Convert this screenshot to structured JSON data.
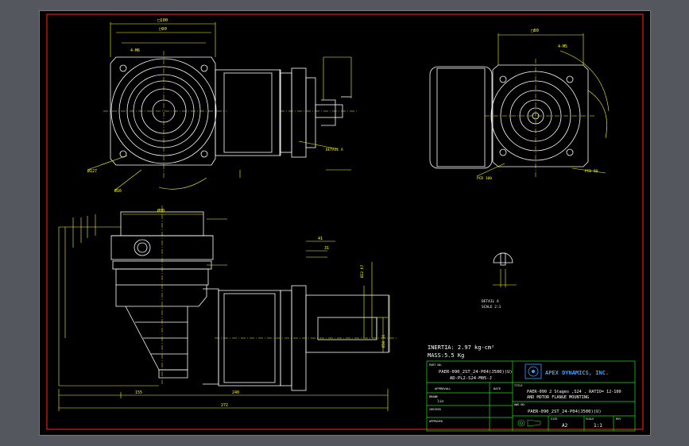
{
  "colors": {
    "background": "#54575e",
    "sheet": "#000000",
    "frame": "#e01b1b",
    "linework": "#ffffff",
    "dimension": "#ffff00",
    "titleblock": "#22dd22",
    "text": "#ffffff"
  },
  "notes": {
    "inertia": "INERTIA: 2.97 kg-cm²",
    "mass": "MASS:5.5 Kg"
  },
  "titleblock": {
    "part_no_label": "PART NO.",
    "part_no_1": "PAER-090_2ST_24-P04(J500)(U)",
    "part_no_2": "AD-PL2-S24-M05-J",
    "company": "APEX DYNAMICS, INC.",
    "title_label": "TITLE",
    "title_1": "PAER-090 2 Stages ,S24 , RATIO= 12-100",
    "title_2": "AND MOTOR FLANGE MOUNTING",
    "dwg_label": "DWG NO.",
    "dwg_no": "PAER-090_2ST_24-P04(J500)(U)",
    "approval_label": "APPROVALL",
    "date_label": "DATE",
    "drawn_label": "DRAWN",
    "drawn_value": "lin",
    "checked_label": "CHECKED",
    "approved_label": "APPROVED",
    "size_label": "SIZE",
    "size_value": "A2",
    "scale_label": "SCALE",
    "scale_value": "1:1",
    "rev_label": "REV"
  },
  "dims": {
    "d_top_1": "□100",
    "d_top_2": "□90",
    "d_top_3": "4-M6",
    "d_side_1": "□80",
    "d_side_2": "4-M5",
    "d_side_3": "PCD 100",
    "d_side_4": "PCD 90",
    "d_left_1": "Ø127",
    "d_left_2": "Ø16",
    "d_bottom_1": "Ø90",
    "d_bottom_2": "272",
    "d_bottom_3": "240",
    "d_bottom_4": "155",
    "d_shaft_1": "Ø22 h7",
    "d_shaft_2": "Ø50 j6",
    "d_detail": "DETAIL A",
    "d_scale": "SCALE 2:1",
    "d_len_1": "41",
    "d_len_2": "31"
  }
}
